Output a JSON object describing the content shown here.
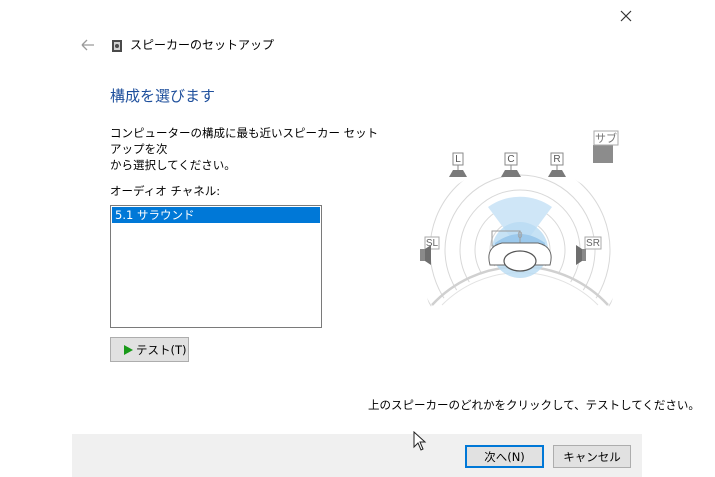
{
  "window": {
    "title": "スピーカーのセットアップ",
    "close_glyph": "✕",
    "back_glyph": "←"
  },
  "page": {
    "heading": "構成を選びます",
    "instruction_line1": "コンピューターの構成に最も近いスピーカー セットアップを次",
    "instruction_line2": "から選択してください。",
    "channels_label": "オーディオ チャネル:",
    "channels": [
      {
        "label": "5.1 サラウンド",
        "selected": true
      }
    ],
    "test_button": "テスト(T)",
    "hint": "上のスピーカーのどれかをクリックして、テストしてください。"
  },
  "speakers": {
    "L": "L",
    "C": "C",
    "R": "R",
    "SL": "SL",
    "SR": "SR",
    "SUB": "サブ"
  },
  "footer": {
    "next_button": "次へ(N)",
    "cancel_button": "キャンセル"
  },
  "colors": {
    "heading": "#1e4f9c",
    "selection": "#0078d7",
    "footer_bg": "#f0f0f0"
  }
}
